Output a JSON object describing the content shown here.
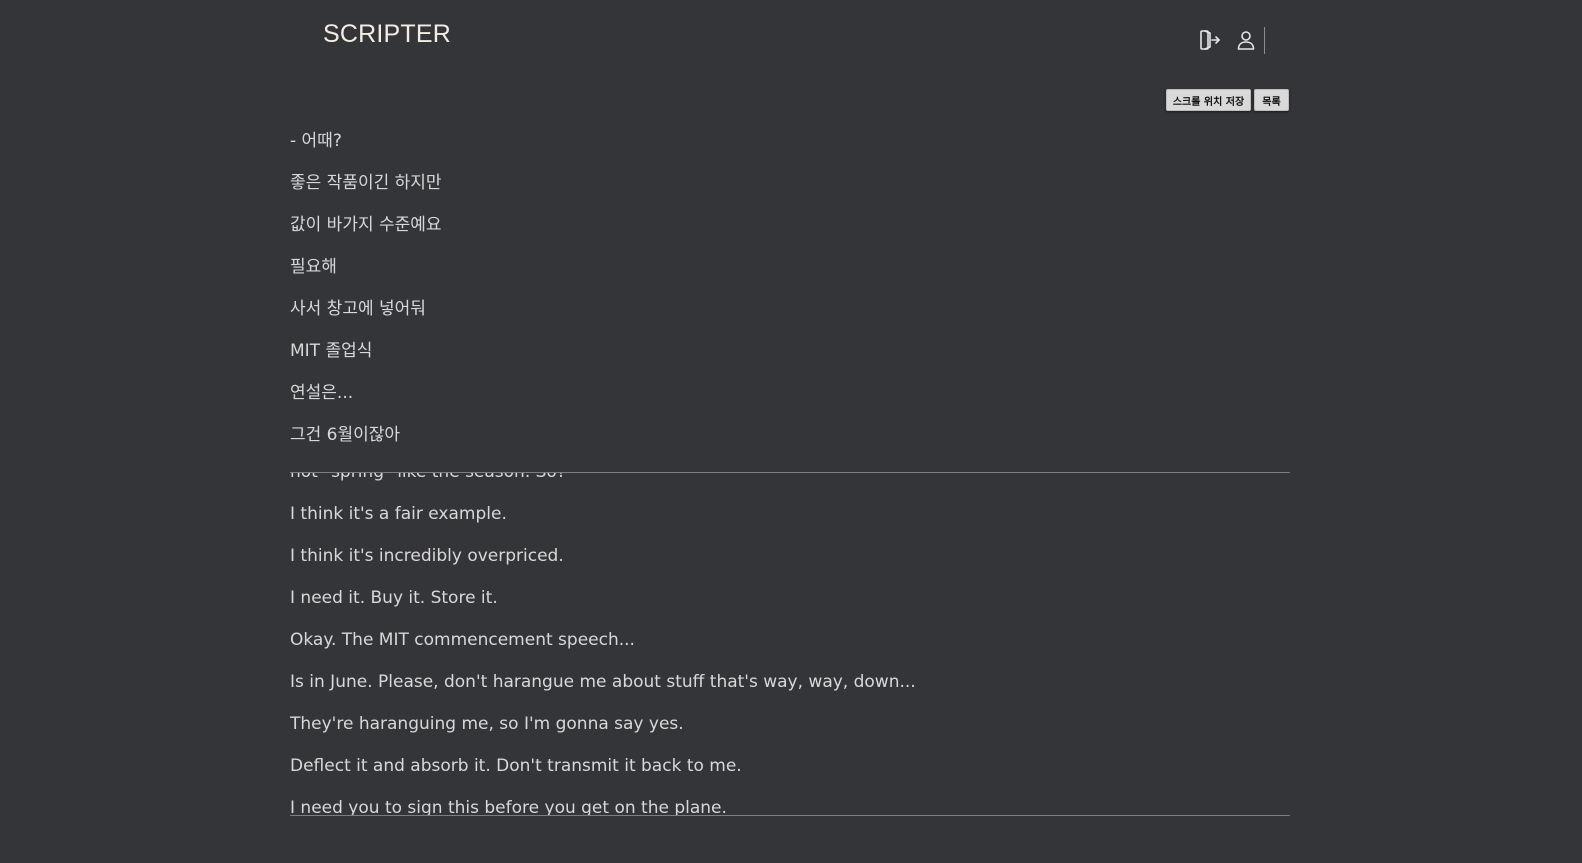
{
  "header": {
    "logo": "SCRIPTER",
    "icons": [
      "logout-icon",
      "user-icon"
    ]
  },
  "toolbar": {
    "save_scroll_label": "스크롤 위치 저장",
    "list_label": "목록"
  },
  "script": {
    "korean_lines": [
      "- 어때?",
      "좋은 작품이긴 하지만",
      "값이 바가지 수준예요",
      "필요해",
      "사서 창고에 넣어둬",
      "MIT 졸업식",
      "연설은...",
      "그건 6월이잖아"
    ],
    "english_lines": [
      "not \"spring\" like the season. So?",
      "I think it's a fair example.",
      "I think it's incredibly overpriced.",
      "I need it. Buy it. Store it.",
      "Okay. The MIT commencement speech...",
      "Is in June. Please, don't harangue me about stuff that's way, way, down...",
      "They're haranguing me, so I'm gonna say yes.",
      "Deflect it and absorb it. Don't transmit it back to me.",
      "I need you to sign this before you get on the plane."
    ]
  },
  "colors": {
    "background": "#343539",
    "text": "#d8d8d8",
    "logo": "#f4ece3",
    "button_bg": "#d9d9d9"
  }
}
